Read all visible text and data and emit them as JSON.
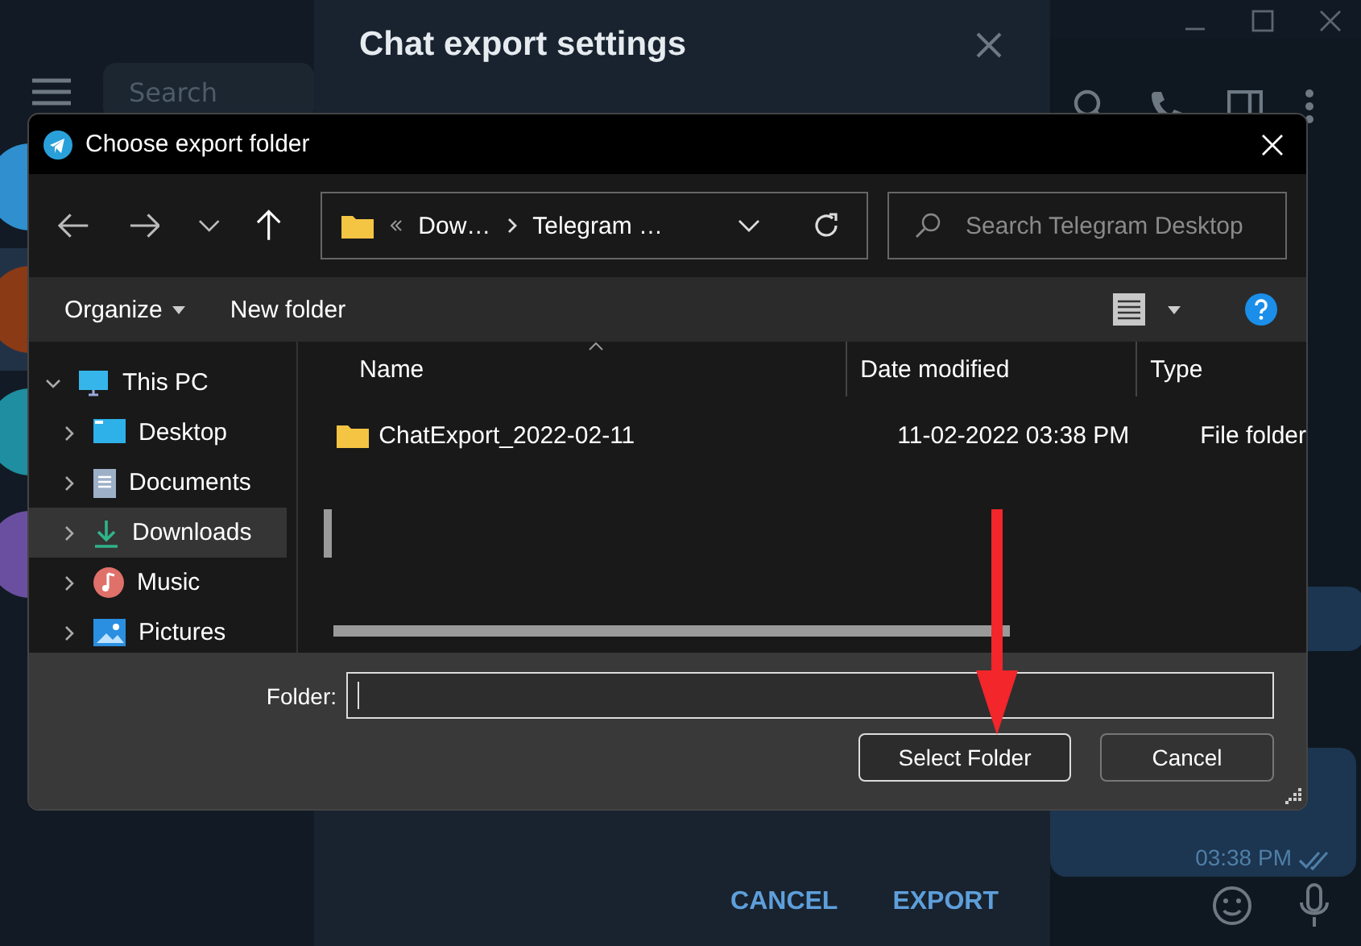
{
  "app": {
    "search": {
      "placeholder": "Search"
    },
    "chats": [
      {
        "color": "#2f8fcf",
        "selected": false
      },
      {
        "color": "#8b3a16",
        "selected": true
      },
      {
        "color": "#1e8ea0",
        "selected": false
      },
      {
        "color": "#6a4fa0",
        "selected": false
      }
    ],
    "message_time": "03:38 PM"
  },
  "export_dialog": {
    "title": "Chat export settings",
    "buttons": [
      "CANCEL",
      "EXPORT"
    ]
  },
  "file_dialog": {
    "title": "Choose export folder",
    "path": [
      "Dow…",
      "Telegram …"
    ],
    "search": {
      "placeholder": "Search Telegram Desktop"
    },
    "toolbar": [
      "Organize",
      "New folder"
    ],
    "tree": [
      {
        "label": "This PC",
        "expanded": true,
        "selected": false,
        "children": [
          {
            "label": "Desktop",
            "expanded": false,
            "selected": false
          },
          {
            "label": "Documents",
            "expanded": false,
            "selected": false
          },
          {
            "label": "Downloads",
            "expanded": false,
            "selected": true
          },
          {
            "label": "Music",
            "expanded": false,
            "selected": false
          },
          {
            "label": "Pictures",
            "expanded": false,
            "selected": false
          }
        ]
      }
    ],
    "columns": [
      "Name",
      "Date modified",
      "Type"
    ],
    "rows": [
      {
        "name": "ChatExport_2022-02-11",
        "date_modified": "11-02-2022 03:38 PM",
        "type": "File folder"
      }
    ],
    "folder_label": "Folder:",
    "buttons": [
      {
        "label": "Select Folder",
        "default": true
      },
      {
        "label": "Cancel",
        "default": false
      }
    ]
  }
}
